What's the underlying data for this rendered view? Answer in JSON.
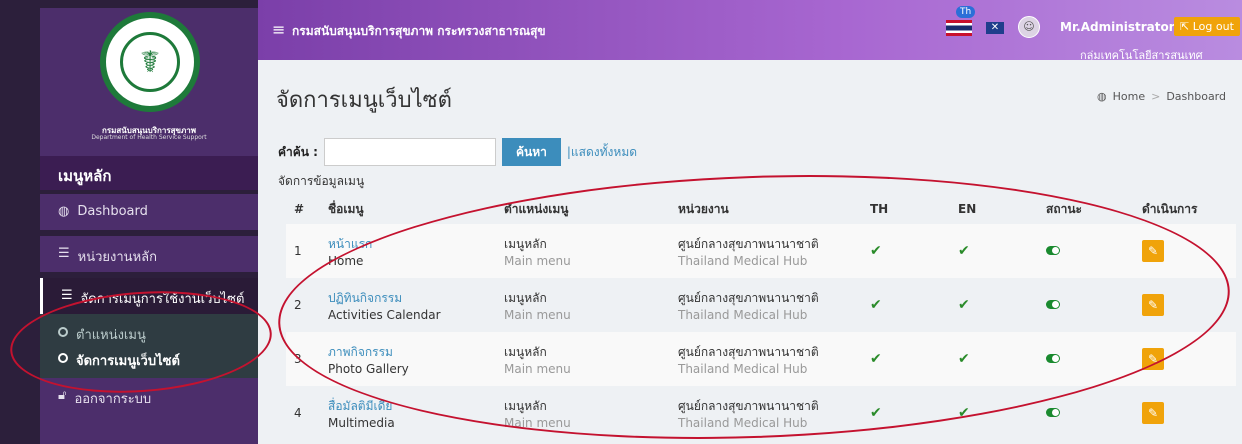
{
  "sidebar": {
    "logo_line1": "กรมสนับสนุนบริการสุขภาพ",
    "logo_line2": "Department of Health Service Support",
    "menu_header": "เมนูหลัก",
    "items": [
      {
        "label": "Dashboard",
        "icon": "dashboard-icon"
      },
      {
        "label": "หน่วยงานหลัก",
        "icon": "list-icon"
      },
      {
        "label": "จัดการเมนูการใช้งานเว็บไซต์",
        "icon": "list-icon"
      }
    ],
    "subitems": [
      {
        "label": "ตำแหน่งเมนู"
      },
      {
        "label": "จัดการเมนูเว็บไซต์"
      }
    ],
    "logout": "ออกจากระบบ"
  },
  "topbar": {
    "site_title": "กรมสนับสนุนบริการสุขภาพ กระทรวงสาธารณสุข",
    "lang_badge": "Th",
    "username": "Mr.Administrator",
    "logout": "Log out",
    "org_name": "กลุ่มเทคโนโลยีสารสนเทศ"
  },
  "page": {
    "title": "จัดการเมนูเว็บไซต์",
    "breadcrumb": [
      "Home",
      "Dashboard"
    ]
  },
  "search": {
    "label": "คำค้น :",
    "value": "",
    "button": "ค้นหา",
    "show_all": "แสดงทั้งหมด"
  },
  "table": {
    "caption": "จัดการข้อมูลเมนู",
    "headers": [
      "#",
      "ชื่อเมนู",
      "ตำแหน่งเมนู",
      "หน่วยงาน",
      "TH",
      "EN",
      "สถานะ",
      "ดำเนินการ"
    ],
    "rows": [
      {
        "no": "1",
        "name_th": "หน้าแรก",
        "name_en": "Home",
        "pos_th": "เมนูหลัก",
        "pos_en": "Main menu",
        "unit_th": "ศูนย์กลางสุขภาพนานาชาติ",
        "unit_en": "Thailand Medical Hub"
      },
      {
        "no": "2",
        "name_th": "ปฏิทินกิจกรรม",
        "name_en": "Activities Calendar",
        "pos_th": "เมนูหลัก",
        "pos_en": "Main menu",
        "unit_th": "ศูนย์กลางสุขภาพนานาชาติ",
        "unit_en": "Thailand Medical Hub"
      },
      {
        "no": "3",
        "name_th": "ภาพกิจกรรม",
        "name_en": "Photo Gallery",
        "pos_th": "เมนูหลัก",
        "pos_en": "Main menu",
        "unit_th": "ศูนย์กลางสุขภาพนานาชาติ",
        "unit_en": "Thailand Medical Hub"
      },
      {
        "no": "4",
        "name_th": "สื่อมัลติมีเดีย",
        "name_en": "Multimedia",
        "pos_th": "เมนูหลัก",
        "pos_en": "Main menu",
        "unit_th": "ศูนย์กลางสุขภาพนานาชาติ",
        "unit_en": "Thailand Medical Hub"
      }
    ]
  },
  "colors": {
    "accent": "#3c8dbc",
    "warning": "#f0a30a",
    "sidebar": "#4c2e6b",
    "annotation": "#c4122f"
  }
}
